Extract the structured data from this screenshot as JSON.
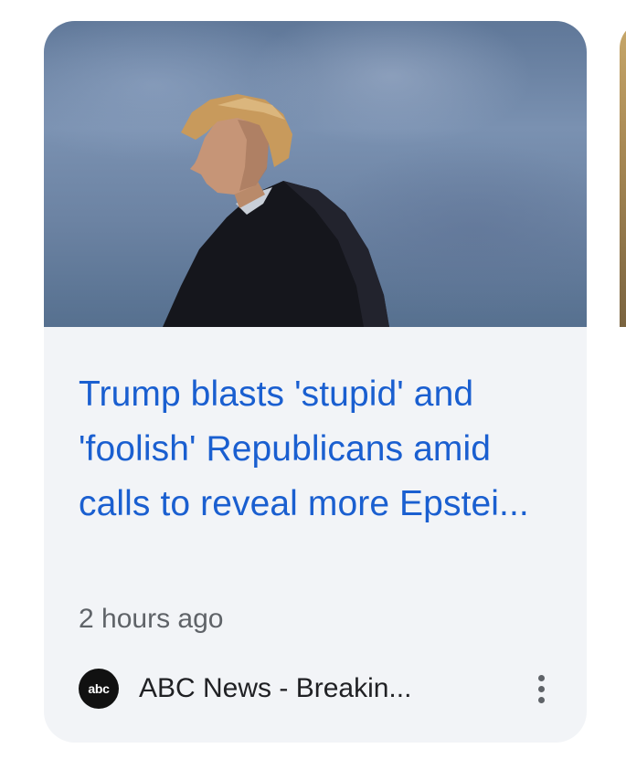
{
  "card": {
    "headline": "Trump blasts 'stupid' and 'foolish' Republicans amid calls to reveal more Epstei...",
    "time_ago": "2 hours ago",
    "source": {
      "logo_text": "abc",
      "name": "ABC News - Breakin..."
    },
    "thumbnail_icon": "photo-person-silhouette-sky",
    "more_icon": "more-vert-icon"
  },
  "colors": {
    "headline": "#1a5fd0",
    "card_background": "#f2f4f7",
    "secondary_text": "#5f6368"
  }
}
